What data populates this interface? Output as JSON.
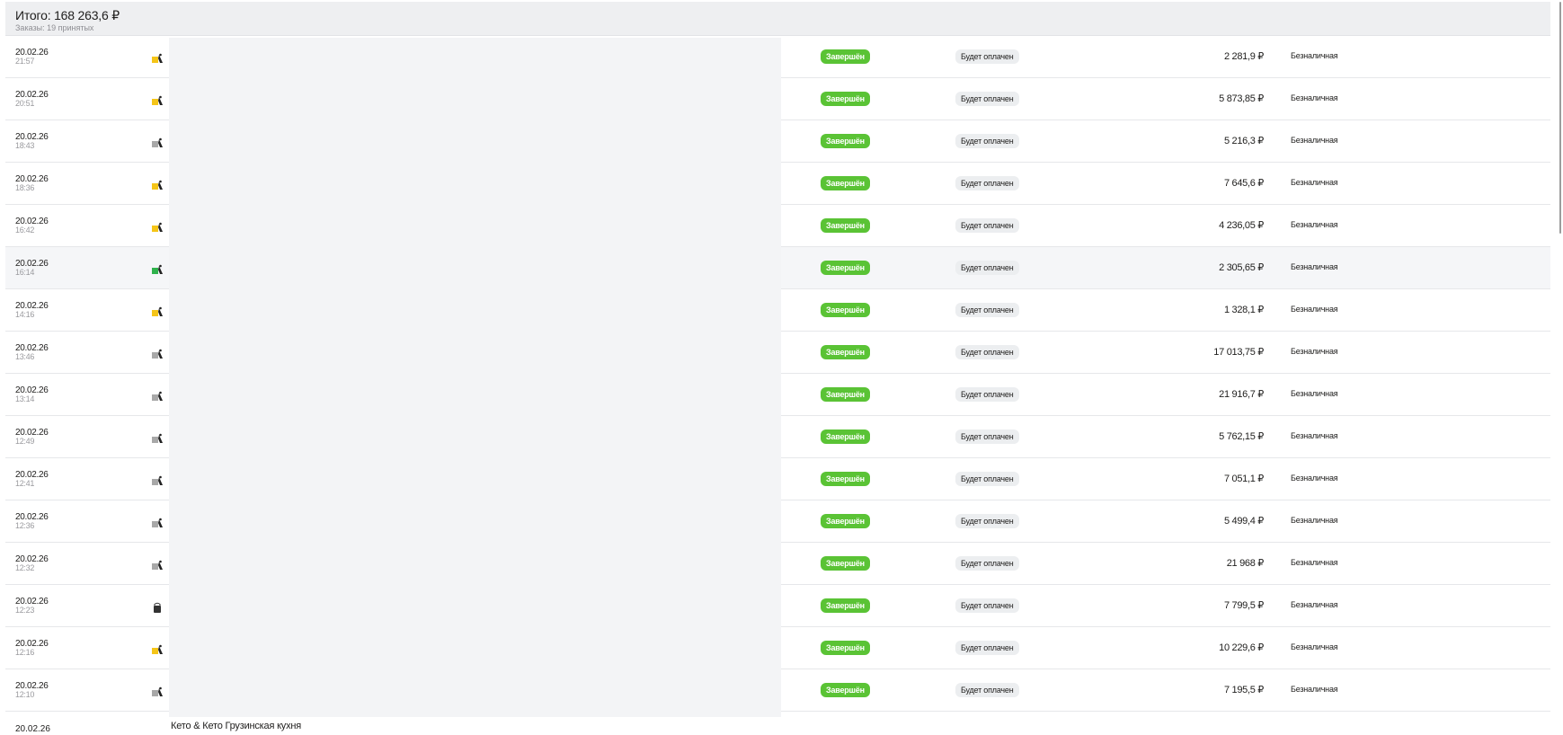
{
  "summary": {
    "total": "Итого: 168 263,6 ₽",
    "orders": "Заказы: 19 принятых"
  },
  "orders": [
    {
      "date": "20.02.26",
      "time": "21:57",
      "icon": "yellow-courier-icon",
      "status": "Завершён",
      "payment_status": "Будет оплачен",
      "amount": "2 281,9 ₽",
      "payment_method": "Безналичная"
    },
    {
      "date": "20.02.26",
      "time": "20:51",
      "icon": "yellow-courier-icon",
      "status": "Завершён",
      "payment_status": "Будет оплачен",
      "amount": "5 873,85 ₽",
      "payment_method": "Безналичная"
    },
    {
      "date": "20.02.26",
      "time": "18:43",
      "icon": "gray-courier-icon",
      "status": "Завершён",
      "payment_status": "Будет оплачен",
      "amount": "5 216,3 ₽",
      "payment_method": "Безналичная"
    },
    {
      "date": "20.02.26",
      "time": "18:36",
      "icon": "yellow-courier-icon",
      "status": "Завершён",
      "payment_status": "Будет оплачен",
      "amount": "7 645,6 ₽",
      "payment_method": "Безналичная"
    },
    {
      "date": "20.02.26",
      "time": "16:42",
      "icon": "yellow-courier-icon",
      "status": "Завершён",
      "payment_status": "Будет оплачен",
      "amount": "4 236,05 ₽",
      "payment_method": "Безналичная"
    },
    {
      "date": "20.02.26",
      "time": "16:14",
      "icon": "green-courier-icon",
      "status": "Завершён",
      "payment_status": "Будет оплачен",
      "amount": "2 305,65 ₽",
      "payment_method": "Безналичная",
      "active": true
    },
    {
      "date": "20.02.26",
      "time": "14:16",
      "icon": "yellow-courier-icon",
      "status": "Завершён",
      "payment_status": "Будет оплачен",
      "amount": "1 328,1 ₽",
      "payment_method": "Безналичная"
    },
    {
      "date": "20.02.26",
      "time": "13:46",
      "icon": "gray-courier-icon",
      "status": "Завершён",
      "payment_status": "Будет оплачен",
      "amount": "17 013,75 ₽",
      "payment_method": "Безналичная"
    },
    {
      "date": "20.02.26",
      "time": "13:14",
      "icon": "gray-courier-icon",
      "status": "Завершён",
      "payment_status": "Будет оплачен",
      "amount": "21 916,7 ₽",
      "payment_method": "Безналичная"
    },
    {
      "date": "20.02.26",
      "time": "12:49",
      "icon": "gray-courier-icon",
      "status": "Завершён",
      "payment_status": "Будет оплачен",
      "amount": "5 762,15 ₽",
      "payment_method": "Безналичная"
    },
    {
      "date": "20.02.26",
      "time": "12:41",
      "icon": "gray-courier-icon",
      "status": "Завершён",
      "payment_status": "Будет оплачен",
      "amount": "7 051,1 ₽",
      "payment_method": "Безналичная"
    },
    {
      "date": "20.02.26",
      "time": "12:36",
      "icon": "gray-courier-icon",
      "status": "Завершён",
      "payment_status": "Будет оплачен",
      "amount": "5 499,4 ₽",
      "payment_method": "Безналичная"
    },
    {
      "date": "20.02.26",
      "time": "12:32",
      "icon": "gray-courier-icon",
      "status": "Завершён",
      "payment_status": "Будет оплачен",
      "amount": "21 968 ₽",
      "payment_method": "Безналичная"
    },
    {
      "date": "20.02.26",
      "time": "12:23",
      "icon": "bag-icon",
      "status": "Завершён",
      "payment_status": "Будет оплачен",
      "amount": "7 799,5 ₽",
      "payment_method": "Безналичная"
    },
    {
      "date": "20.02.26",
      "time": "12:16",
      "icon": "yellow-courier-icon",
      "status": "Завершён",
      "payment_status": "Будет оплачен",
      "amount": "10 229,6 ₽",
      "payment_method": "Безналичная"
    },
    {
      "date": "20.02.26",
      "time": "12:10",
      "icon": "gray-courier-icon",
      "status": "Завершён",
      "payment_status": "Будет оплачен",
      "amount": "7 195,5 ₽",
      "payment_method": "Безналичная"
    }
  ],
  "partial_row": {
    "date": "20.02.26",
    "restaurant": "Кето & Кето Грузинская кухня"
  },
  "colors": {
    "status_green": "#5ac335",
    "header_bg": "#eeeff1",
    "masked_area": "#f3f4f6",
    "courier_yellow": "#f5c518",
    "courier_gray": "#a8a8a8",
    "courier_green": "#2fb24c"
  }
}
